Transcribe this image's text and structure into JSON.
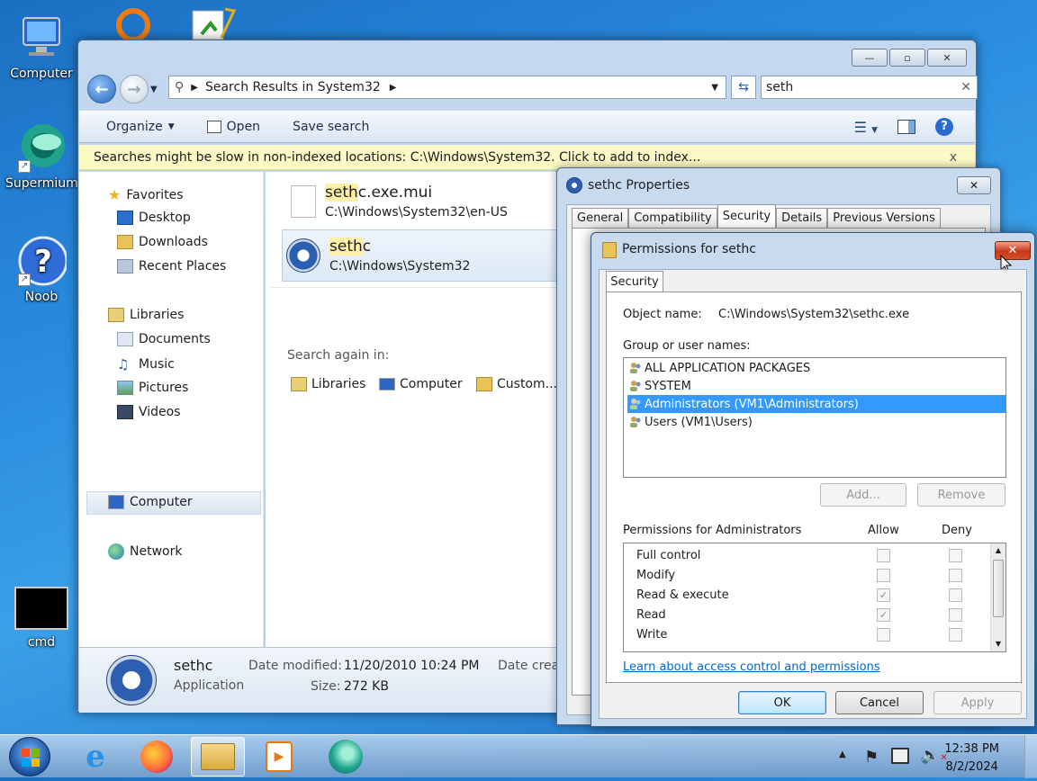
{
  "desktop": {
    "icons": [
      {
        "label": "Computer"
      },
      {
        "label": "Supermium"
      },
      {
        "label": "Noob"
      },
      {
        "label": "cmd"
      }
    ]
  },
  "explorer": {
    "caption_buttons": {
      "minimize": "—",
      "maximize": "▫",
      "close": "✕"
    },
    "address": {
      "path": "Search Results in System32"
    },
    "search": {
      "value": "seth",
      "clear": "✕"
    },
    "toolbar": {
      "organize": "Organize",
      "open": "Open",
      "save_search": "Save search"
    },
    "infobar": {
      "text": "Searches might be slow in non-indexed locations: C:\\Windows\\System32. Click to add to index...",
      "close": "x"
    },
    "nav": {
      "favorites": "Favorites",
      "desktop": "Desktop",
      "downloads": "Downloads",
      "recent": "Recent Places",
      "libraries": "Libraries",
      "documents": "Documents",
      "music": "Music",
      "pictures": "Pictures",
      "videos": "Videos",
      "computer": "Computer",
      "network": "Network"
    },
    "results": [
      {
        "name_hl": "seth",
        "name_rest": "c.exe.mui",
        "path": "C:\\Windows\\System32\\en-US"
      },
      {
        "name_hl": "seth",
        "name_rest": "c",
        "path": "C:\\Windows\\System32"
      }
    ],
    "search_again": {
      "label": "Search again in:",
      "libraries": "Libraries",
      "computer": "Computer",
      "custom": "Custom..."
    },
    "details": {
      "name": "sethc",
      "type": "Application",
      "modified_label": "Date modified:",
      "modified_value": "11/20/2010 10:24 PM",
      "size_label": "Size:",
      "size_value": "272 KB",
      "created_label": "Date crea"
    }
  },
  "properties": {
    "title": "sethc Properties",
    "close": "✕",
    "tabs": [
      "General",
      "Compatibility",
      "Security",
      "Details",
      "Previous Versions"
    ]
  },
  "permissions": {
    "title": "Permissions for sethc",
    "close": "✕",
    "tab": "Security",
    "object_label": "Object name:",
    "object_value": "C:\\Windows\\System32\\sethc.exe",
    "group_label": "Group or user names:",
    "users": [
      "ALL APPLICATION PACKAGES",
      "SYSTEM",
      "Administrators (VM1\\Administrators)",
      "Users (VM1\\Users)"
    ],
    "add": "Add...",
    "remove": "Remove",
    "perm_header": "Permissions for Administrators",
    "allow": "Allow",
    "deny": "Deny",
    "perms": [
      {
        "name": "Full control",
        "allow": false,
        "deny": false
      },
      {
        "name": "Modify",
        "allow": false,
        "deny": false
      },
      {
        "name": "Read & execute",
        "allow": true,
        "deny": false
      },
      {
        "name": "Read",
        "allow": true,
        "deny": false
      },
      {
        "name": "Write",
        "allow": false,
        "deny": false
      }
    ],
    "link": "Learn about access control and permissions",
    "ok": "OK",
    "cancel": "Cancel",
    "apply": "Apply"
  },
  "taskbar": {
    "time": "12:38 PM",
    "date": "8/2/2024"
  }
}
